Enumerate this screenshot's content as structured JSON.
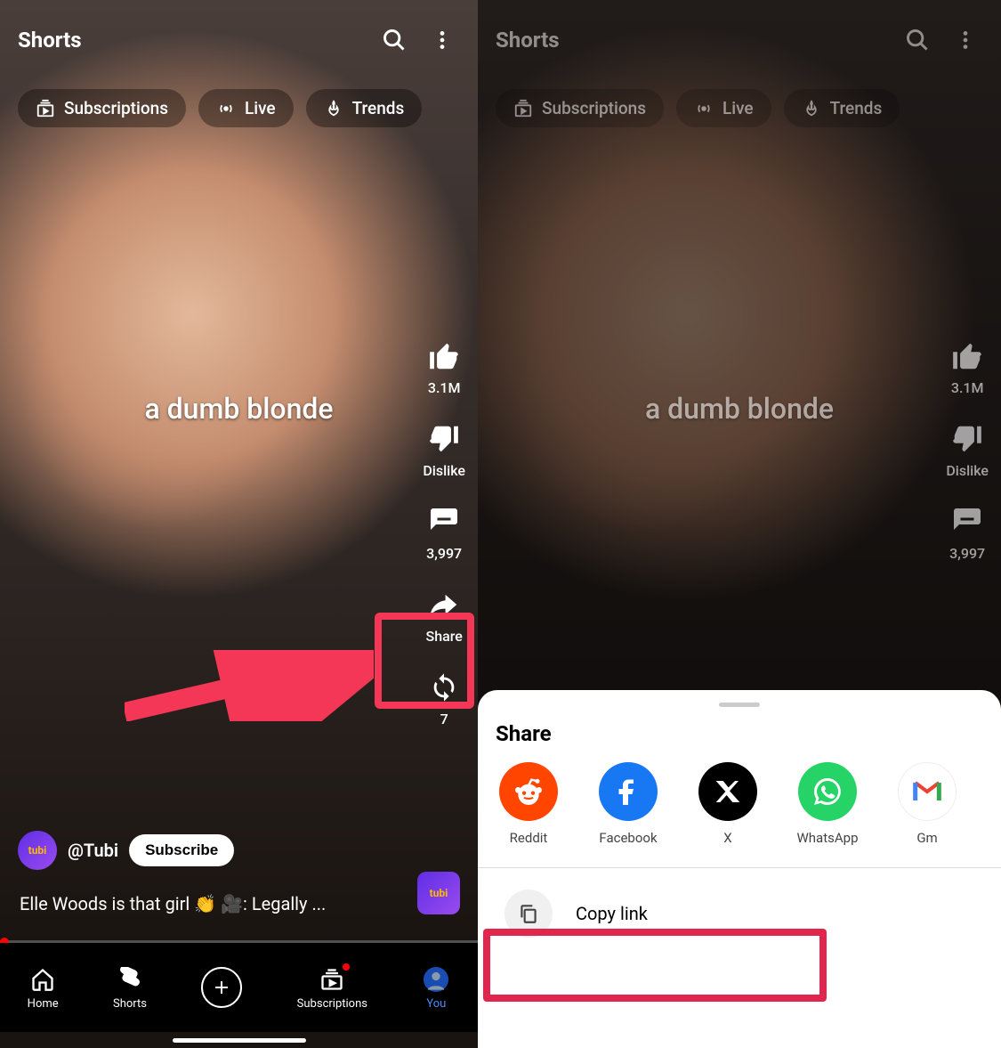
{
  "header": {
    "title": "Shorts"
  },
  "chips": {
    "subscriptions": "Subscriptions",
    "live": "Live",
    "trends": "Trends"
  },
  "caption": "a dumb blonde",
  "rail": {
    "like_count": "3.1M",
    "dislike_label": "Dislike",
    "comment_count": "3,997",
    "share_label": "Share",
    "remix_count": "7"
  },
  "channel": {
    "avatar_text": "tubi",
    "handle": "@Tubi",
    "subscribe": "Subscribe"
  },
  "description": "Elle Woods is that girl 👏 🎥: Legally ...",
  "sound_badge": "tubi",
  "nav": {
    "home": "Home",
    "shorts": "Shorts",
    "subscriptions": "Subscriptions",
    "you": "You"
  },
  "share_sheet": {
    "title": "Share",
    "apps": {
      "reddit": "Reddit",
      "facebook": "Facebook",
      "x": "X",
      "whatsapp": "WhatsApp",
      "gmail": "Gm"
    },
    "copy_link": "Copy link"
  }
}
